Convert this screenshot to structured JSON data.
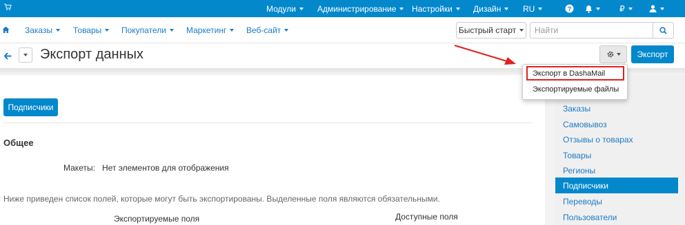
{
  "topbar": {
    "menus": [
      {
        "label": "Модули",
        "caret": true
      },
      {
        "label": "Администрирование",
        "caret": true
      },
      {
        "label": "Настройки",
        "caret": true
      },
      {
        "label": "Дизайн",
        "caret": true
      },
      {
        "label": "RU",
        "caret": true
      },
      {
        "label": "",
        "caret": false,
        "icon": "help-icon"
      },
      {
        "label": "",
        "caret": true,
        "icon": "bell-icon"
      },
      {
        "label": "₽",
        "caret": true
      },
      {
        "label": "",
        "caret": true,
        "icon": "user-icon"
      }
    ]
  },
  "nav": {
    "items": [
      {
        "label": "Заказы"
      },
      {
        "label": "Товары"
      },
      {
        "label": "Покупатели"
      },
      {
        "label": "Маркетинг"
      },
      {
        "label": "Веб-сайт"
      }
    ],
    "quick_start": "Быстрый старт",
    "search_placeholder": "Найти"
  },
  "page": {
    "title": "Экспорт данных",
    "export_button": "Экспорт"
  },
  "dropdown": {
    "items": [
      "Экспорт в DashaMail",
      "Экспортируемые файлы"
    ]
  },
  "main": {
    "tab_button": "Подписчики",
    "section_title": "Общее",
    "layouts_label": "Макеты:",
    "layouts_value": "Нет элементов для отображения",
    "hint": "Ниже приведен список полей, которые могут быть экспортированы. Выделенные поля являются обязательными.",
    "exported_fields": "Экспортируемые поля",
    "available_fields": "Доступные поля"
  },
  "sidebar": {
    "items": [
      {
        "label": "Заказы",
        "active": false
      },
      {
        "label": "Самовывоз",
        "active": false
      },
      {
        "label": "Отзывы о товарах",
        "active": false
      },
      {
        "label": "Товары",
        "active": false
      },
      {
        "label": "Регионы",
        "active": false
      },
      {
        "label": "Подписчики",
        "active": true
      },
      {
        "label": "Переводы",
        "active": false
      },
      {
        "label": "Пользователи",
        "active": false
      }
    ]
  },
  "colors": {
    "primary": "#0388cc",
    "link": "#1b7bc6",
    "annotation": "#e02020"
  }
}
